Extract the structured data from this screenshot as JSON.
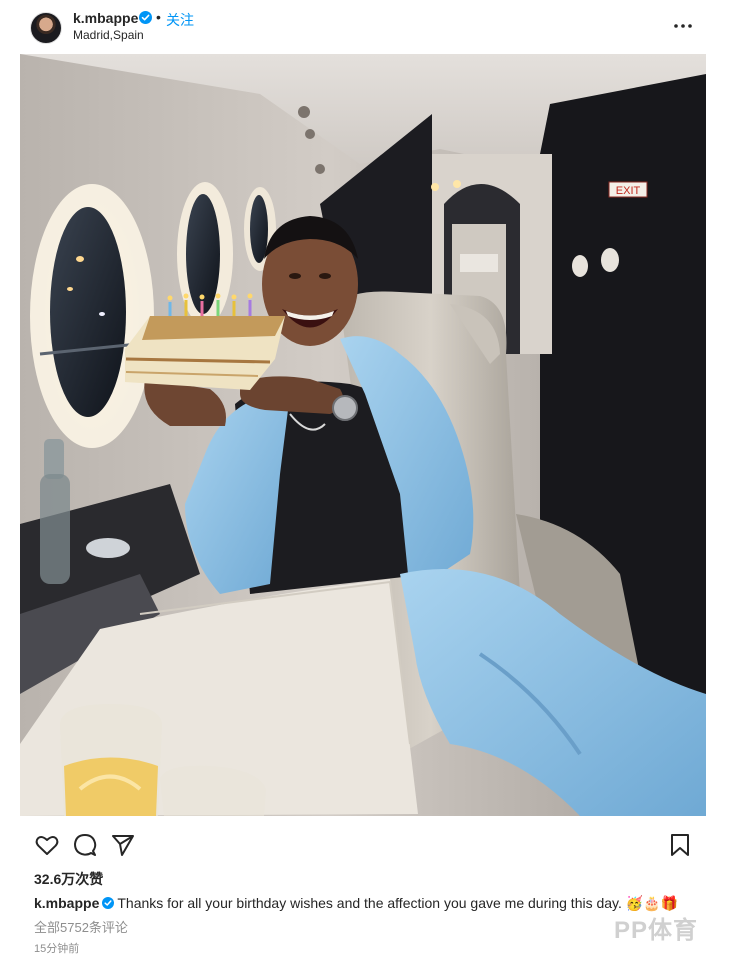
{
  "header": {
    "username": "k.mbappe",
    "separator": "•",
    "follow_label": "关注",
    "location": "Madrid,Spain",
    "more_icon": "more-horizontal-icon"
  },
  "photo": {
    "exit_sign": "EXIT"
  },
  "actions": {
    "like_icon": "heart-icon",
    "comment_icon": "comment-icon",
    "share_icon": "paper-plane-icon",
    "save_icon": "bookmark-icon"
  },
  "post": {
    "likes": "32.6万次赞",
    "caption_user": "k.mbappe",
    "caption_text": "Thanks for all your birthday wishes and the affection you gave me during this day. 🥳🎂🎁",
    "comments_link": "全部5752条评论",
    "time_ago": "15分钟前"
  },
  "watermark": {
    "text": "PP体育"
  },
  "colors": {
    "verified": "#0095f6",
    "follow": "#0095f6",
    "muted": "#8e8e8e",
    "hoodie": "#8fc3e6"
  }
}
